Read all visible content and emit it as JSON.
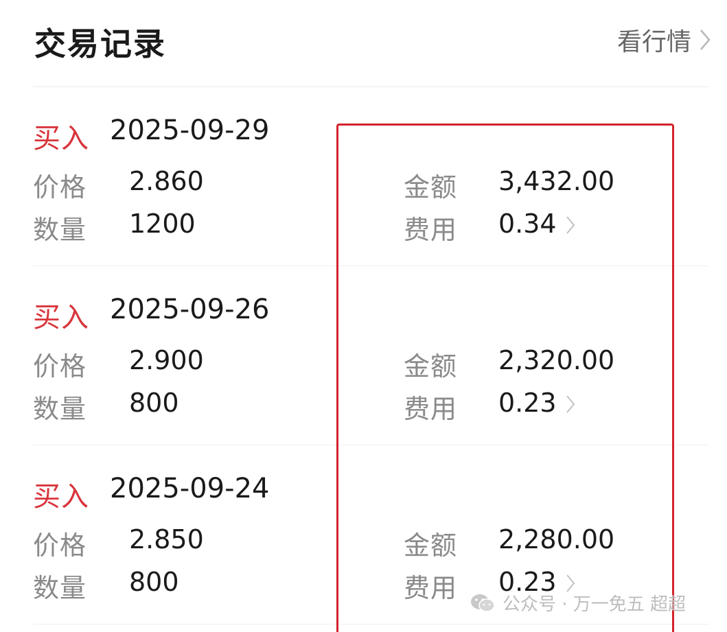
{
  "header": {
    "title": "交易记录",
    "market_link_label": "看行情"
  },
  "labels": {
    "price": "价格",
    "quantity": "数量",
    "amount": "金额",
    "fee": "费用"
  },
  "records": [
    {
      "type": "买入",
      "date": "2025-09-29",
      "price": "2.860",
      "quantity": "1200",
      "amount": "3,432.00",
      "fee": "0.34"
    },
    {
      "type": "买入",
      "date": "2025-09-26",
      "price": "2.900",
      "quantity": "800",
      "amount": "2,320.00",
      "fee": "0.23"
    },
    {
      "type": "买入",
      "date": "2025-09-24",
      "price": "2.850",
      "quantity": "800",
      "amount": "2,280.00",
      "fee": "0.23"
    }
  ],
  "watermark": {
    "text": "公众号 · 万一免五 超超",
    "icon": "wechat-icon"
  },
  "colors": {
    "buy": "#d8353c",
    "highlight": "#d4232b",
    "label": "#8a8a8a",
    "value": "#1a1a1a"
  }
}
